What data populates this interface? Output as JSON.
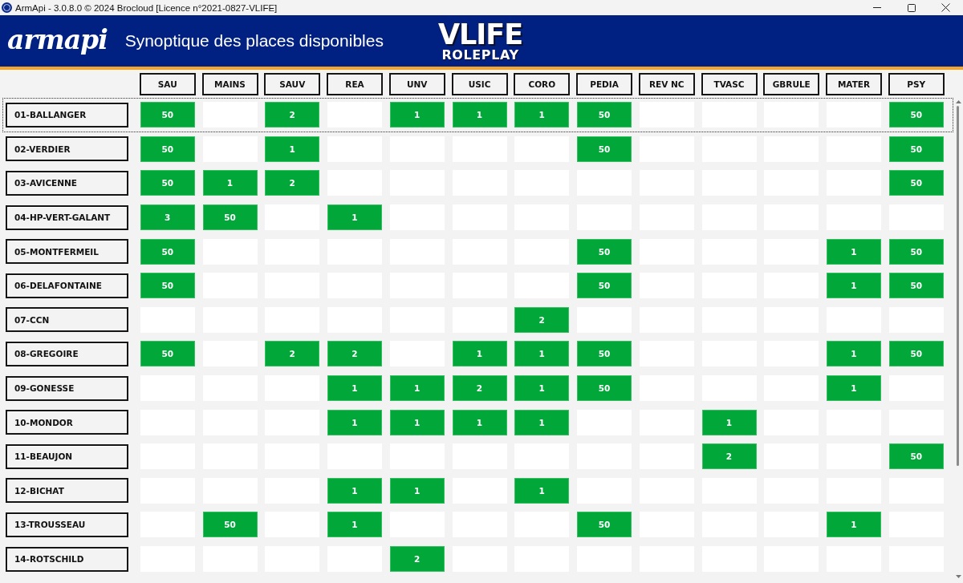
{
  "window": {
    "title": "ArmApi - 3.0.8.0 © 2024 Brocloud [Licence n°2021-0827-VLIFE]"
  },
  "header": {
    "logo_text": "armapi",
    "title": "Synoptique des places disponibles",
    "brand": {
      "line_1": "VLIFE",
      "line_2": "ROLEPLAY"
    }
  },
  "columns": [
    "SAU",
    "MAINS",
    "SAUV",
    "REA",
    "UNV",
    "USIC",
    "CORO",
    "PEDIA",
    "REV NC",
    "TVASC",
    "GBRULE",
    "MATER",
    "PSY"
  ],
  "rows": [
    {
      "name": "01-BALLANGER",
      "selected": true,
      "cells": [
        "50",
        null,
        "2",
        null,
        "1",
        "1",
        "1",
        "50",
        null,
        null,
        null,
        null,
        "50"
      ]
    },
    {
      "name": "02-VERDIER",
      "selected": false,
      "cells": [
        "50",
        null,
        "1",
        null,
        null,
        null,
        null,
        "50",
        null,
        null,
        null,
        null,
        "50"
      ]
    },
    {
      "name": "03-AVICENNE",
      "selected": false,
      "cells": [
        "50",
        "1",
        "2",
        null,
        null,
        null,
        null,
        null,
        null,
        null,
        null,
        null,
        "50"
      ]
    },
    {
      "name": "04-HP-VERT-GALANT",
      "selected": false,
      "cells": [
        "3",
        "50",
        null,
        "1",
        null,
        null,
        null,
        null,
        null,
        null,
        null,
        null,
        null
      ]
    },
    {
      "name": "05-MONTFERMEIL",
      "selected": false,
      "cells": [
        "50",
        null,
        null,
        null,
        null,
        null,
        null,
        "50",
        null,
        null,
        null,
        "1",
        "50"
      ]
    },
    {
      "name": "06-DELAFONTAINE",
      "selected": false,
      "cells": [
        "50",
        null,
        null,
        null,
        null,
        null,
        null,
        "50",
        null,
        null,
        null,
        "1",
        "50"
      ]
    },
    {
      "name": "07-CCN",
      "selected": false,
      "cells": [
        null,
        null,
        null,
        null,
        null,
        null,
        "2",
        null,
        null,
        null,
        null,
        null,
        null
      ]
    },
    {
      "name": "08-GREGOIRE",
      "selected": false,
      "cells": [
        "50",
        null,
        "2",
        "2",
        null,
        "1",
        "1",
        "50",
        null,
        null,
        null,
        "1",
        "50"
      ]
    },
    {
      "name": "09-GONESSE",
      "selected": false,
      "cells": [
        null,
        null,
        null,
        "1",
        "1",
        "2",
        "1",
        "50",
        null,
        null,
        null,
        "1",
        null
      ]
    },
    {
      "name": "10-MONDOR",
      "selected": false,
      "cells": [
        null,
        null,
        null,
        "1",
        "1",
        "1",
        "1",
        null,
        null,
        "1",
        null,
        null,
        null
      ]
    },
    {
      "name": "11-BEAUJON",
      "selected": false,
      "cells": [
        null,
        null,
        null,
        null,
        null,
        null,
        null,
        null,
        null,
        "2",
        null,
        null,
        "50"
      ]
    },
    {
      "name": "12-BICHAT",
      "selected": false,
      "cells": [
        null,
        null,
        null,
        "1",
        "1",
        null,
        "1",
        null,
        null,
        null,
        null,
        null,
        null
      ]
    },
    {
      "name": "13-TROUSSEAU",
      "selected": false,
      "cells": [
        null,
        "50",
        null,
        "1",
        null,
        null,
        null,
        "50",
        null,
        null,
        null,
        "1",
        null
      ]
    },
    {
      "name": "14-ROTSCHILD",
      "selected": false,
      "cells": [
        null,
        null,
        null,
        null,
        "2",
        null,
        null,
        null,
        null,
        null,
        null,
        null,
        null
      ]
    }
  ]
}
